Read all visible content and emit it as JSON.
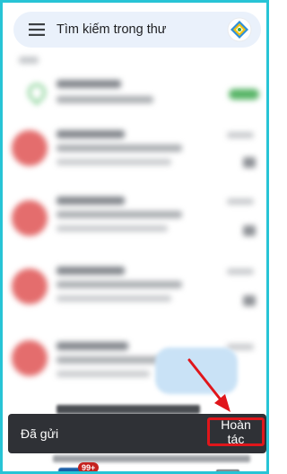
{
  "search": {
    "placeholder": "Tìm kiếm trong thư"
  },
  "snackbar": {
    "message": "Đã gửi",
    "undo_label": "Hoàn tác"
  },
  "bottom_nav": {
    "mail_badge": "99+"
  },
  "colors": {
    "frame_border": "#27c4d6",
    "search_bg": "#eaf1fb",
    "snackbar_bg": "#2f3136",
    "highlight": "#e0161b",
    "sender_avatar": "#e46d6d",
    "badge": "#c5221f"
  },
  "icons": {
    "menu": "menu-icon",
    "account": "account-avatar-icon",
    "compose": "pencil-icon",
    "mail": "mail-icon",
    "video": "video-icon"
  }
}
